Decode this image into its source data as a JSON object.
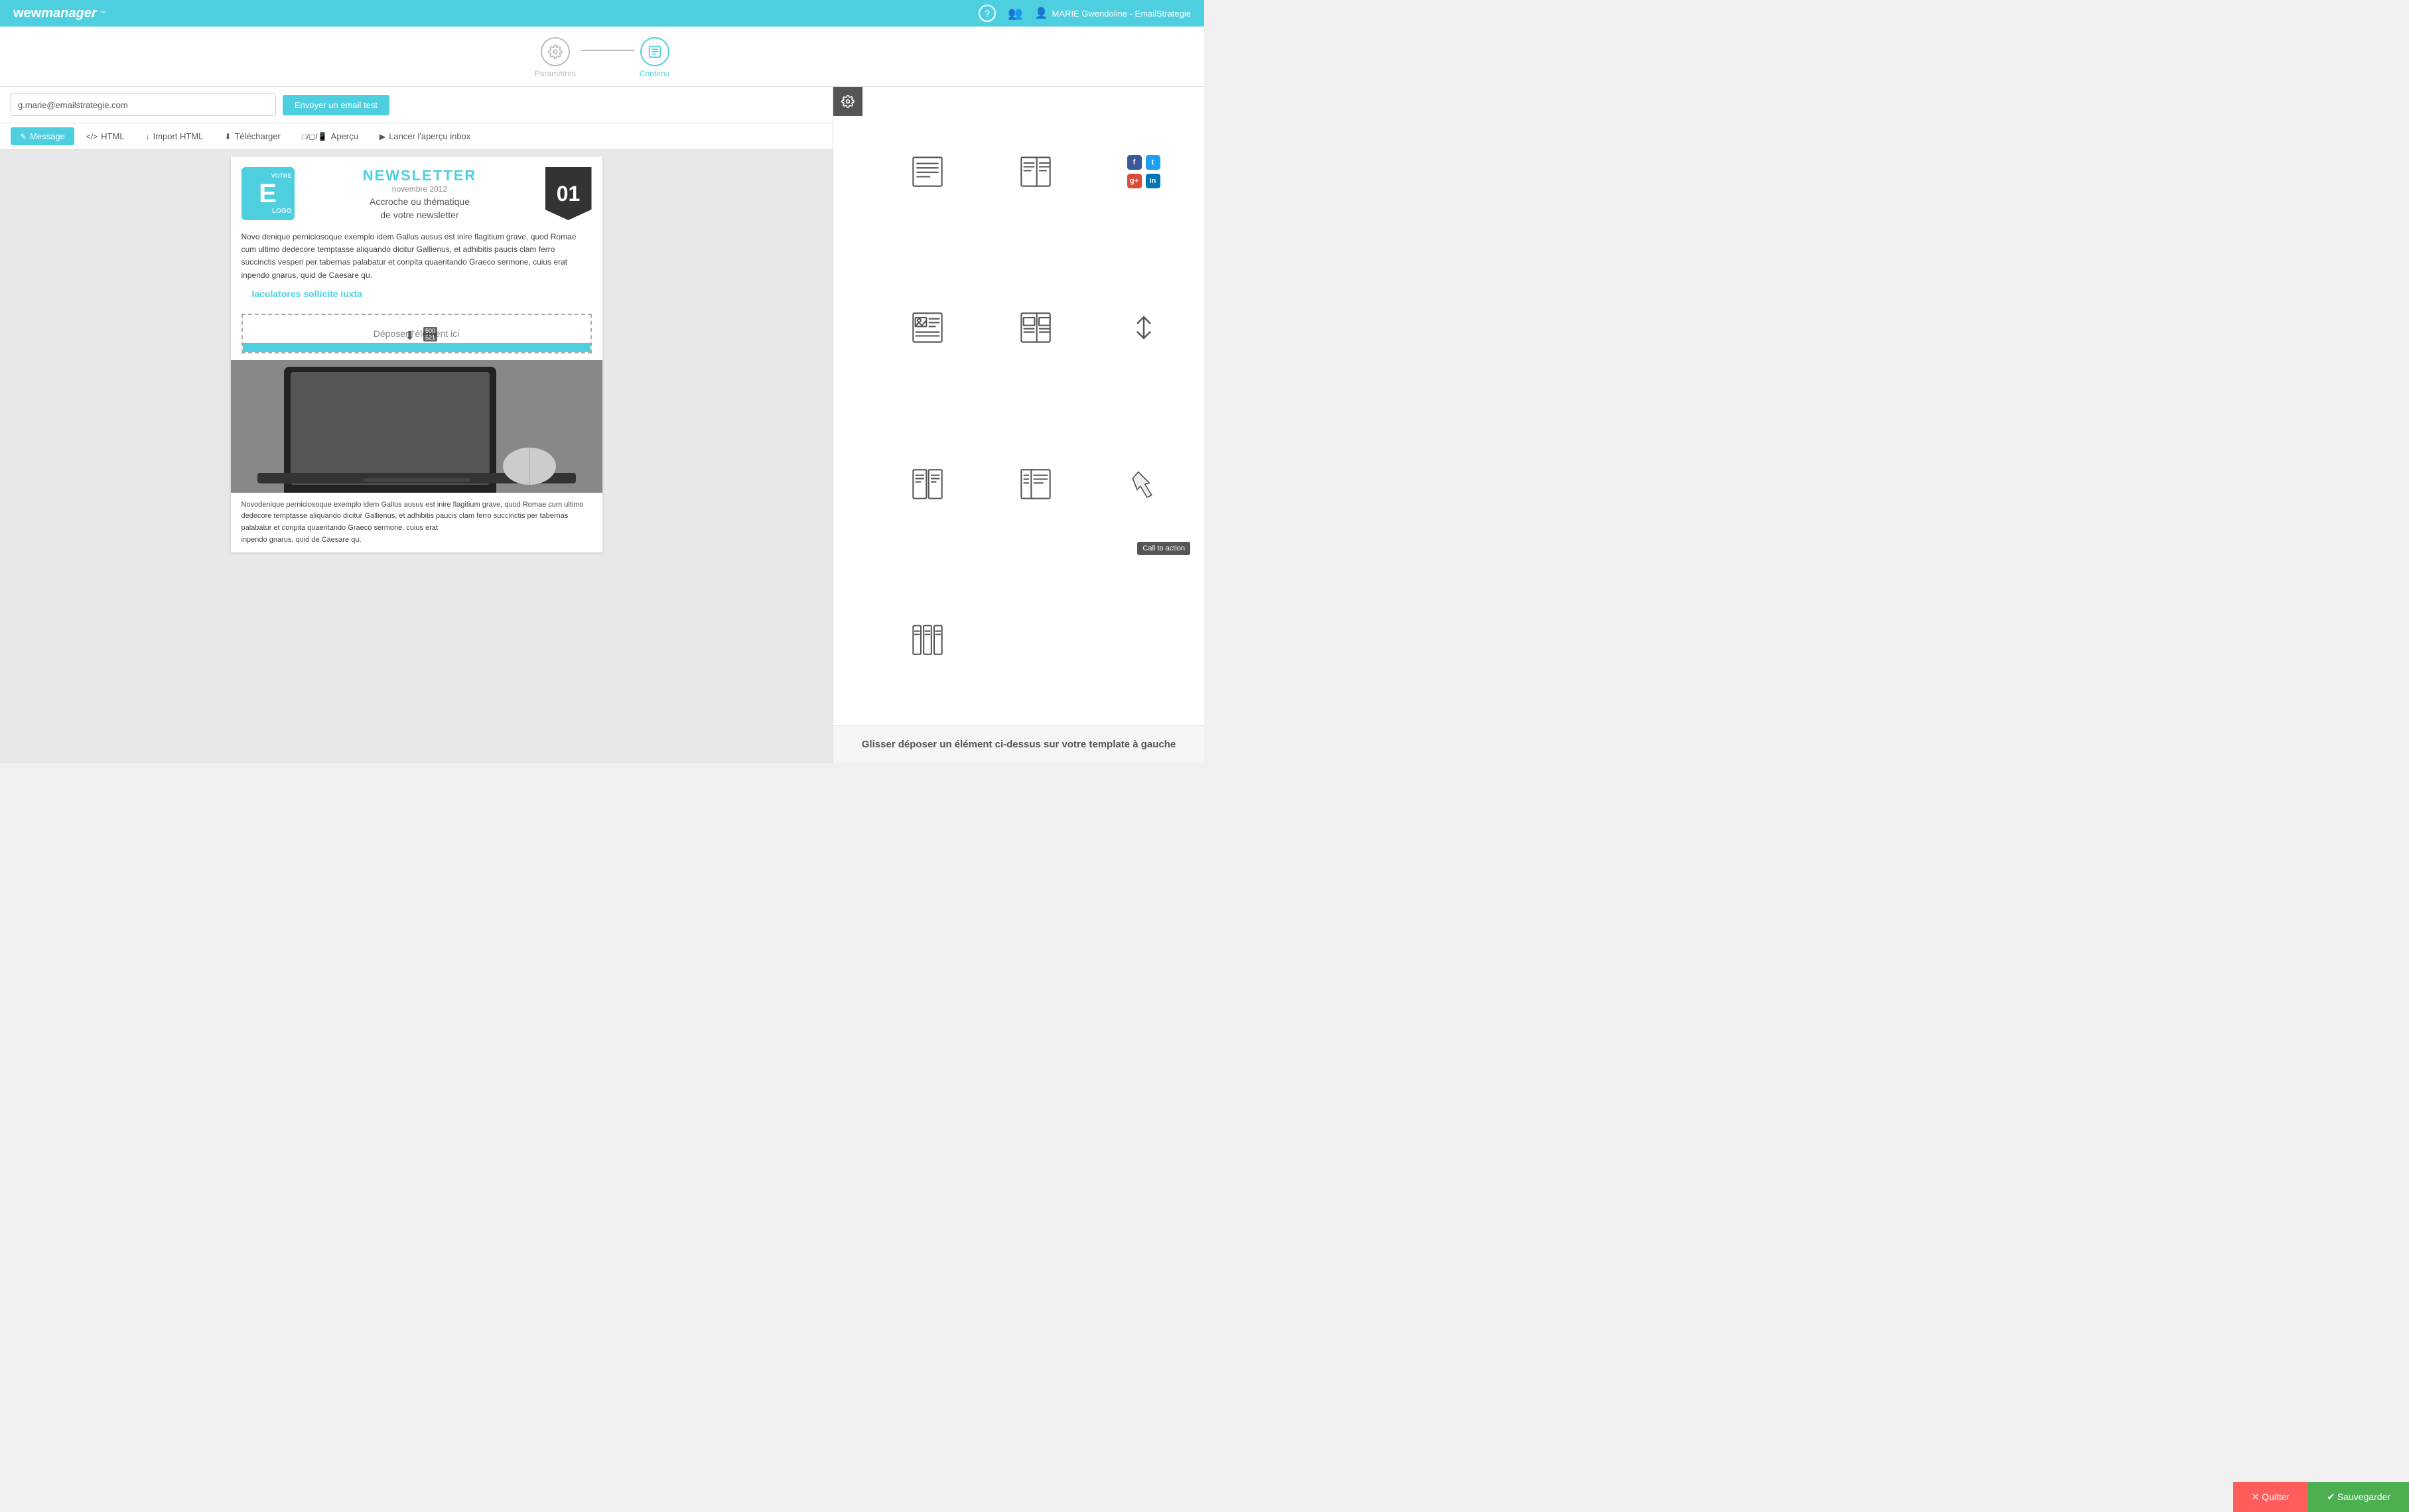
{
  "navbar": {
    "logo_wew": "wew",
    "logo_manager": "manager",
    "user_icon": "👤",
    "help_icon": "?",
    "users_icon": "👥",
    "user_name": "MARIE Gwendoline - EmailStrategie"
  },
  "stepper": {
    "step1_label": "Paramètres",
    "step2_label": "Contenu",
    "step1_icon": "⚙",
    "step2_icon": "≡"
  },
  "test_bar": {
    "input_value": "g.marie@emailstrategie.com",
    "send_button": "Envoyer un email test"
  },
  "toolbar": {
    "message_tab": "Message",
    "html_tab": "HTML",
    "import_tab": "Import HTML",
    "download_tab": "Télécharger",
    "preview_tab": "Aperçu",
    "inbox_tab": "Lancer l'aperçu inbox"
  },
  "newsletter": {
    "title": "NEWSLETTER",
    "date": "novembre 2012",
    "number": "01",
    "subtitle1": "Accroche ou thématique",
    "subtitle2": "de votre newsletter",
    "body_text": "Novo denique perniciosoque exemplo idem Gallus ausus est inire flagitium grave, quod Romae cum ultimo dedecore temptasse aliquando dicitur Gallienus, et adhibitis paucis clam ferro succinctis vesperi per tabernas palabatur et conpita quaeritando Graeco sermone, cuius erat inpendo gnarus, quid de Caesare qu.",
    "link_text": "Iaculatores sollicite iuxta",
    "drop_zone_text": "Déposer l'élément ici",
    "coords": "500\n521",
    "footer_text": "Novodenique perniciosoque exemplo idem Gallus ausus est inire flagitium grave, quod Romae cum ultimo dedecore temptasse aliquando dicitur Gallienus, et adhibitis paucis clam ferro succinctis per tabernas palabatur et conpita quaeritando Graeco sermone, cuius erat\ninpendo gnarus, quid de Caesare qu."
  },
  "elements_panel": {
    "gear_icon": "⚙",
    "drag_instruction": "Glisser déposer un élément ci-dessus sur votre template à gauche",
    "cta_tooltip": "Call to action",
    "elements": [
      {
        "id": "text-block",
        "label": "Text block"
      },
      {
        "id": "two-col-text",
        "label": "Two column text"
      },
      {
        "id": "social",
        "label": "Social"
      },
      {
        "id": "image-text",
        "label": "Image text"
      },
      {
        "id": "two-col-layout",
        "label": "Two column layout"
      },
      {
        "id": "arrows",
        "label": "Arrows"
      },
      {
        "id": "two-col-border",
        "label": "Two column border"
      },
      {
        "id": "two-col-right",
        "label": "Two column right"
      },
      {
        "id": "cta",
        "label": "Call to action"
      },
      {
        "id": "three-col",
        "label": "Three column"
      }
    ]
  },
  "bottom_bar": {
    "quitter_label": "✕ Quitter",
    "sauvegarder_label": "✔ Sauvegarder"
  }
}
